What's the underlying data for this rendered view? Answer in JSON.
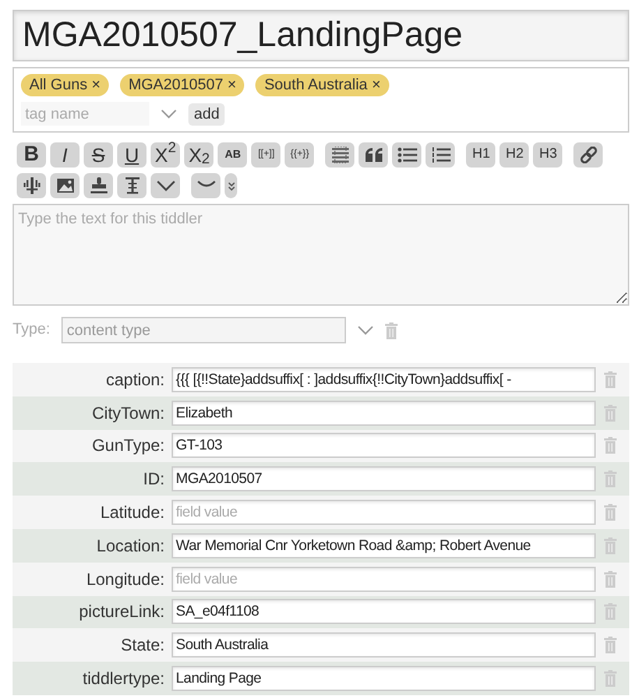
{
  "title": "MGA2010507_LandingPage",
  "tags": [
    {
      "label": "All Guns",
      "remove": "×"
    },
    {
      "label": "MGA2010507",
      "remove": "×"
    },
    {
      "label": "South Australia",
      "remove": "×"
    }
  ],
  "tag_input": {
    "placeholder": "tag name",
    "button": "add"
  },
  "toolbar_rows": [
    [
      [
        {
          "kind": "bold",
          "label": "B"
        },
        {
          "kind": "italic",
          "label": "I"
        },
        {
          "kind": "strike",
          "label": "S"
        },
        {
          "kind": "underline",
          "label": "U"
        },
        {
          "kind": "text",
          "label": "X$^{2}$"
        },
        {
          "kind": "text",
          "label": "X$_{2}$"
        },
        {
          "kind": "smallcaps",
          "label": "AB"
        },
        {
          "kind": "tiny",
          "label": "[[+]]"
        },
        {
          "kind": "tiny",
          "label": "{{+}}"
        }
      ],
      [
        {
          "kind": "excise"
        },
        {
          "kind": "quote"
        },
        {
          "kind": "bullets"
        },
        {
          "kind": "numbers"
        }
      ],
      [
        {
          "kind": "heading",
          "label": "H1"
        },
        {
          "kind": "heading",
          "label": "H2"
        },
        {
          "kind": "heading",
          "label": "H3"
        }
      ],
      [
        {
          "kind": "link"
        }
      ]
    ],
    [
      [
        {
          "kind": "preview"
        },
        {
          "kind": "picture"
        },
        {
          "kind": "stamp"
        },
        {
          "kind": "transclude"
        },
        {
          "kind": "more"
        }
      ],
      [
        {
          "kind": "smiley"
        },
        {
          "kind": "dropdown"
        }
      ]
    ]
  ],
  "body": {
    "placeholder": "Type the text for this tiddler"
  },
  "type_row": {
    "label": "Type:",
    "placeholder": "content type"
  },
  "fields": [
    {
      "label": "caption:",
      "value": "{{{ [{!!State}addsuffix[ : ]addsuffix{!!CityTown}addsuffix[ -"
    },
    {
      "label": "CityTown:",
      "value": "Elizabeth"
    },
    {
      "label": "GunType:",
      "value": "GT-103"
    },
    {
      "label": "ID:",
      "value": "MGA2010507"
    },
    {
      "label": "Latitude:",
      "placeholder": "field value"
    },
    {
      "label": "Location:",
      "value": "War Memorial Cnr Yorketown Road &amp; Robert Avenue"
    },
    {
      "label": "Longitude:",
      "placeholder": "field value"
    },
    {
      "label": "pictureLink:",
      "value": "SA_e04f1108"
    },
    {
      "label": "State:",
      "value": "South Australia"
    },
    {
      "label": "tiddlertype:",
      "value": "Landing Page"
    }
  ]
}
